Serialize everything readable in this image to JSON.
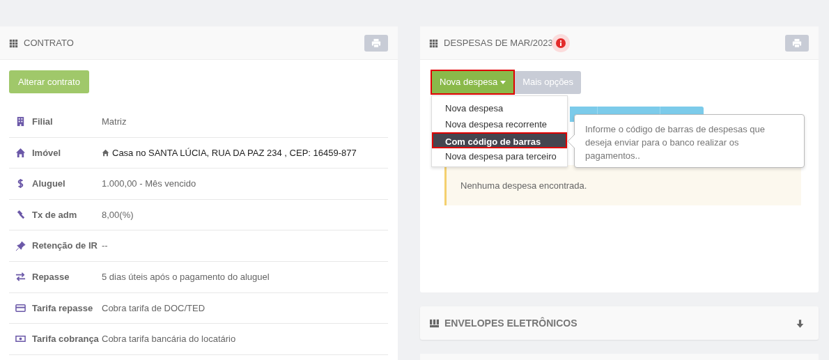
{
  "contract": {
    "title": "CONTRATO",
    "edit_button": "Alterar contrato",
    "rows": [
      {
        "label": "Filial",
        "value": "Matriz"
      },
      {
        "label": "Imóvel",
        "value": "Casa no SANTA LÚCIA, RUA DA PAZ 234 , CEP: 16459-877"
      },
      {
        "label": "Aluguel",
        "value": "1.000,00 - Mês vencido"
      },
      {
        "label": "Tx de adm",
        "value": "8,00(%)"
      },
      {
        "label": "Retenção de IR",
        "value": "--"
      },
      {
        "label": "Repasse",
        "value": "5 dias úteis após o pagamento do aluguel"
      },
      {
        "label": "Tarifa repasse",
        "value": "Cobra tarifa de DOC/TED"
      },
      {
        "label": "Tarifa cobrança",
        "value": "Cobra tarifa bancária do locatário"
      }
    ]
  },
  "expenses": {
    "title": "DESPESAS DE MAR/2023",
    "new_button": "Nova despesa",
    "more_button": "Mais opções",
    "menu": [
      {
        "label": "Nova despesa",
        "selected": false
      },
      {
        "label": "Nova despesa recorrente",
        "selected": false
      },
      {
        "label": "Com código de barras",
        "selected": true
      },
      {
        "label": "Nova despesa para terceiro",
        "selected": false
      }
    ],
    "tooltip": "Informe o código de barras de despesas que deseja enviar para o banco realizar os pagamentos..",
    "empty_message": "Nenhuma despesa encontrada."
  },
  "envelopes": {
    "title": "ENVELOPES ELETRÔNICOS"
  }
}
